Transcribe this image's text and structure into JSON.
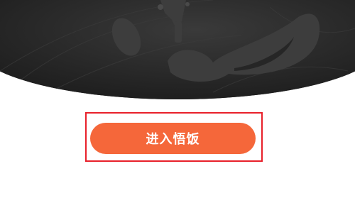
{
  "login": {
    "enter_button_label": "进入悟饭"
  },
  "colors": {
    "hero_bg": "#262626",
    "button_bg": "#f5673a",
    "highlight_border": "#e8202a"
  }
}
